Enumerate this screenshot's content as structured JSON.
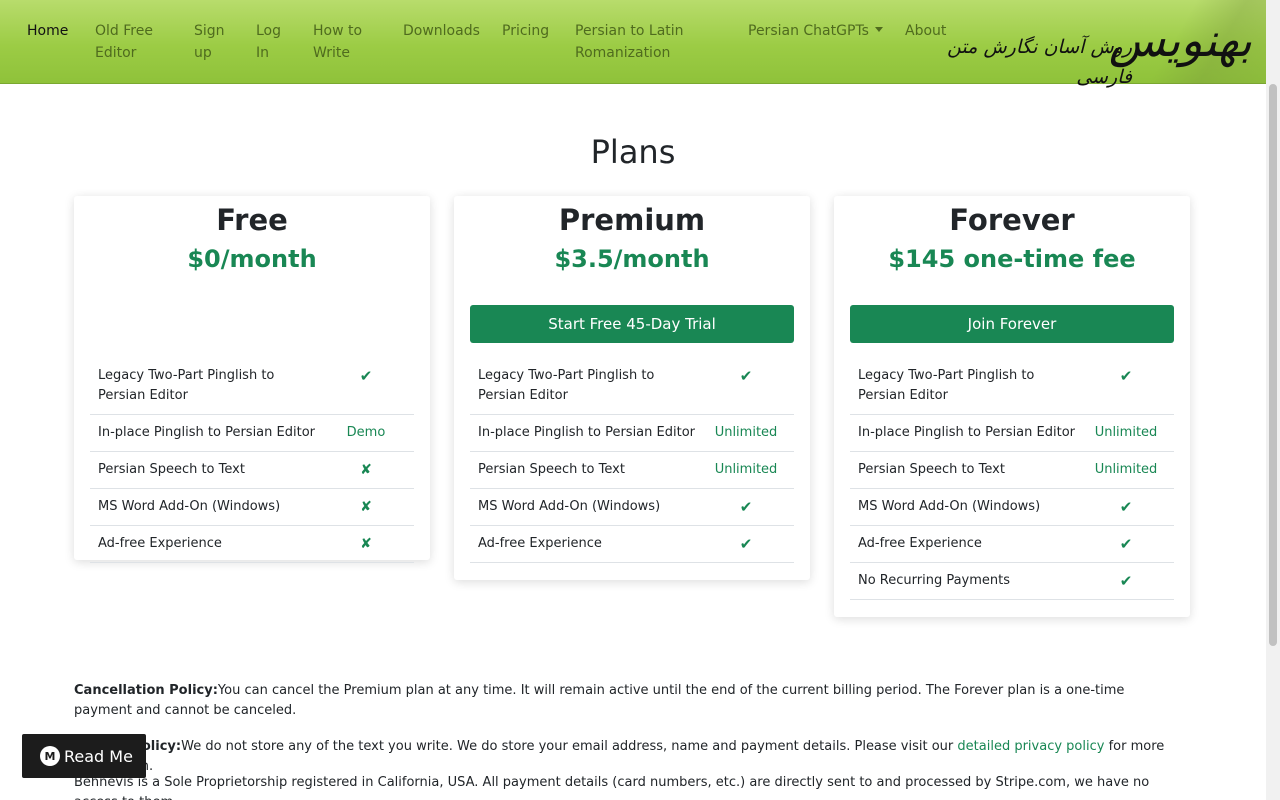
{
  "nav": {
    "items": [
      {
        "label": "Home",
        "active": true
      },
      {
        "label": "Old Free\nEditor"
      },
      {
        "label": "Sign\nup"
      },
      {
        "label": "Log\nIn"
      },
      {
        "label": "How to\nWrite"
      },
      {
        "label": "Downloads"
      },
      {
        "label": "Pricing"
      },
      {
        "label": "Persian to Latin\nRomanization"
      },
      {
        "label": "Persian ChatGPTs"
      },
      {
        "label": "About"
      }
    ],
    "logo_text": "بهنویس",
    "logo_tagline": "روش آسان نگارش متن فارسی"
  },
  "page_title": "Plans",
  "plans": [
    {
      "name": "Free",
      "price": "$0/month",
      "features": [
        {
          "name": "Legacy Two-Part Pinglish to Persian Editor",
          "value": "✔"
        },
        {
          "name": "In-place Pinglish to Persian Editor",
          "value": "Demo"
        },
        {
          "name": "Persian Speech to Text",
          "value": "✘"
        },
        {
          "name": "MS Word Add-On (Windows)",
          "value": "✘"
        },
        {
          "name": "Ad-free Experience",
          "value": "✘"
        }
      ]
    },
    {
      "name": "Premium",
      "price": "$3.5/month",
      "cta": "Start Free 45-Day Trial",
      "features": [
        {
          "name": "Legacy Two-Part Pinglish to Persian Editor",
          "value": "✔"
        },
        {
          "name": "In-place Pinglish to Persian Editor",
          "value": "Unlimited"
        },
        {
          "name": "Persian Speech to Text",
          "value": "Unlimited"
        },
        {
          "name": "MS Word Add-On (Windows)",
          "value": "✔"
        },
        {
          "name": "Ad-free Experience",
          "value": "✔"
        }
      ]
    },
    {
      "name": "Forever",
      "price": "$145 one-time fee",
      "cta": "Join Forever",
      "features": [
        {
          "name": "Legacy Two-Part Pinglish to Persian Editor",
          "value": "✔"
        },
        {
          "name": "In-place Pinglish to Persian Editor",
          "value": "Unlimited"
        },
        {
          "name": "Persian Speech to Text",
          "value": "Unlimited"
        },
        {
          "name": "MS Word Add-On (Windows)",
          "value": "✔"
        },
        {
          "name": "Ad-free Experience",
          "value": "✔"
        },
        {
          "name": "No Recurring Payments",
          "value": "✔"
        }
      ]
    }
  ],
  "policies": {
    "cancellation_label": "Cancellation Policy:",
    "cancellation_text": "You can cancel the Premium plan at any time. It will remain active until the end of the current billing period. The Forever plan is a one-time payment and cannot be canceled.",
    "privacy_label": "Privacy Policy:",
    "privacy_text": "We do not store any of the text you write. We do store your email address, name and payment details. Please visit our ",
    "privacy_link": "detailed privacy policy",
    "privacy_after": " for more information.",
    "business_text": "Behnevis is a Sole Proprietorship registered in California, USA. All payment details (card numbers, etc.) are directly sent to and processed by Stripe.com, we have no access to them."
  },
  "readme": {
    "label": "Read Me",
    "icon": "readme-logo-icon"
  }
}
